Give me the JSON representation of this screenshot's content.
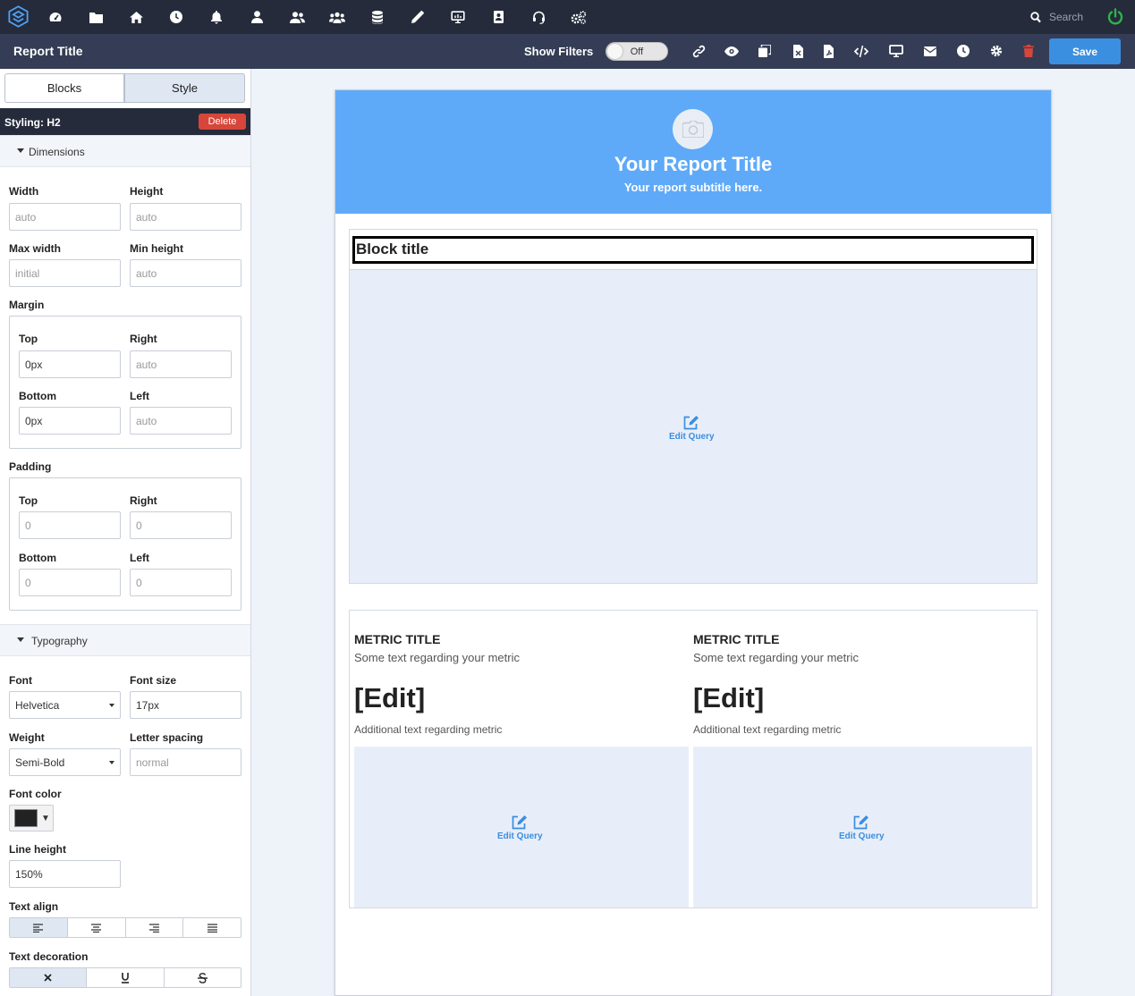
{
  "topnav": {
    "icons": [
      "logo-icon",
      "dashboard-icon",
      "folder-icon",
      "home-icon",
      "clock-icon",
      "bell-icon",
      "user-icon",
      "users-icon",
      "user-groups-icon",
      "database-icon",
      "pencil-icon",
      "monitor-icon",
      "address-book-icon",
      "support-icon",
      "cogs-icon"
    ],
    "search_placeholder": "Search"
  },
  "toolbar": {
    "report_title": "Report Title",
    "show_filters_label": "Show Filters",
    "filters_toggle": "Off",
    "save_label": "Save"
  },
  "sidebar": {
    "tabs": [
      "Blocks",
      "Style"
    ],
    "active_tab": "Style",
    "styling_label": "Styling: H2",
    "delete_label": "Delete",
    "dimensions": {
      "section": "Dimensions",
      "width_label": "Width",
      "width_placeholder": "auto",
      "height_label": "Height",
      "height_placeholder": "auto",
      "maxwidth_label": "Max width",
      "maxwidth_placeholder": "initial",
      "minheight_label": "Min height",
      "minheight_placeholder": "auto",
      "margin_label": "Margin",
      "margin": {
        "top_label": "Top",
        "top_value": "0px",
        "right_label": "Right",
        "right_placeholder": "auto",
        "bottom_label": "Bottom",
        "bottom_value": "0px",
        "left_label": "Left",
        "left_placeholder": "auto"
      },
      "padding_label": "Padding",
      "padding": {
        "top_label": "Top",
        "top_placeholder": "0",
        "right_label": "Right",
        "right_placeholder": "0",
        "bottom_label": "Bottom",
        "bottom_placeholder": "0",
        "left_label": "Left",
        "left_placeholder": "0"
      }
    },
    "typography": {
      "section": "Typography",
      "font_label": "Font",
      "font_value": "Helvetica",
      "fontsize_label": "Font size",
      "fontsize_value": "17px",
      "weight_label": "Weight",
      "weight_value": "Semi-Bold",
      "letterspacing_label": "Letter spacing",
      "letterspacing_placeholder": "normal",
      "fontcolor_label": "Font color",
      "font_color": "#222222",
      "lineheight_label": "Line height",
      "lineheight_value": "150%",
      "textalign_label": "Text align",
      "textalign_active": "left",
      "textdecoration_label": "Text decoration"
    }
  },
  "report": {
    "title": "Your Report Title",
    "subtitle": "Your report subtitle here.",
    "block_title": "Block title",
    "edit_query_label": "Edit Query",
    "metrics": [
      {
        "title": "METRIC TITLE",
        "text": "Some text regarding your metric",
        "value": "[Edit]",
        "additional": "Additional text regarding metric"
      },
      {
        "title": "METRIC TITLE",
        "text": "Some text regarding your metric",
        "value": "[Edit]",
        "additional": "Additional text regarding metric"
      }
    ]
  },
  "colors": {
    "nav_bg": "#252b3b",
    "toolbar_bg": "#343d55",
    "accent": "#3b8fe0",
    "hero_bg": "#5eaaf8",
    "danger": "#d6463a",
    "power": "#2fb24b"
  }
}
